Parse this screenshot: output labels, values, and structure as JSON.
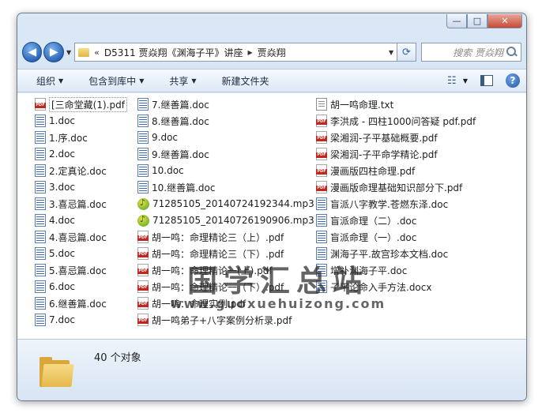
{
  "window": {
    "caption": {
      "minimize": "—",
      "maximize": "□",
      "close": "✕"
    }
  },
  "nav": {
    "back_icon": "back-arrow-icon",
    "forward_icon": "forward-arrow-icon",
    "address": {
      "chevron": "«",
      "segments": [
        "D5311 贾焱翔《渊海子平》讲座",
        "贾焱翔"
      ]
    },
    "search_placeholder": "搜索 贾焱翔"
  },
  "toolbar": {
    "organize": "组织",
    "include_in_library": "包含到库中",
    "share": "共享",
    "new_folder": "新建文件夹"
  },
  "files": {
    "col1": [
      {
        "name": "[三命堂藏(1).pdf",
        "type": "pdf",
        "selected": true
      },
      {
        "name": "1.doc",
        "type": "doc"
      },
      {
        "name": "1.序.doc",
        "type": "doc"
      },
      {
        "name": "2.doc",
        "type": "doc"
      },
      {
        "name": "2.定真论.doc",
        "type": "doc"
      },
      {
        "name": "3.doc",
        "type": "doc"
      },
      {
        "name": "3.喜忌篇.doc",
        "type": "doc"
      },
      {
        "name": "4.doc",
        "type": "doc"
      },
      {
        "name": "4.喜忌篇.doc",
        "type": "doc"
      },
      {
        "name": "5.doc",
        "type": "doc"
      },
      {
        "name": "5.喜忌篇.doc",
        "type": "doc"
      },
      {
        "name": "6.doc",
        "type": "doc"
      },
      {
        "name": "6.继善篇.doc",
        "type": "doc"
      },
      {
        "name": "7.doc",
        "type": "doc"
      }
    ],
    "col2": [
      {
        "name": "7.继善篇.doc",
        "type": "doc"
      },
      {
        "name": "8.继善篇.doc",
        "type": "doc"
      },
      {
        "name": "9.doc",
        "type": "doc"
      },
      {
        "name": "9.继善篇.doc",
        "type": "doc"
      },
      {
        "name": "10.doc",
        "type": "doc"
      },
      {
        "name": "10.继善篇.doc",
        "type": "doc"
      },
      {
        "name": "71285105_20140724192344.mp3",
        "type": "mp3"
      },
      {
        "name": "71285105_20140726190906.mp3",
        "type": "mp3"
      },
      {
        "name": "胡一鸣：命理精论三（上）.pdf",
        "type": "pdf"
      },
      {
        "name": "胡一鸣：命理精论三（下）.pdf",
        "type": "pdf"
      },
      {
        "name": "胡一鸣：命理精论一(上).pdf",
        "type": "pdf"
      },
      {
        "name": "胡一鸣：命理精论一（下）.pdf",
        "type": "pdf"
      },
      {
        "name": "胡一鸣：命理实例.pdf",
        "type": "pdf"
      },
      {
        "name": "胡一鸣弟子+八字案例分析录.pdf",
        "type": "pdf"
      }
    ],
    "col3": [
      {
        "name": "胡一鸣命理.txt",
        "type": "txt"
      },
      {
        "name": "李洪成 - 四柱1000问答疑 pdf.pdf",
        "type": "pdf"
      },
      {
        "name": "梁湘润-子平基础概要.pdf",
        "type": "pdf"
      },
      {
        "name": "梁湘润-子平命学精论.pdf",
        "type": "pdf"
      },
      {
        "name": "漫画版四柱命理.pdf",
        "type": "pdf"
      },
      {
        "name": "漫画版命理基础知识部分下.pdf",
        "type": "pdf"
      },
      {
        "name": "盲派八字教学.苍燃东泽.doc",
        "type": "doc"
      },
      {
        "name": "盲派命理（二）.doc",
        "type": "doc"
      },
      {
        "name": "盲派命理（一）.doc",
        "type": "doc"
      },
      {
        "name": "渊海子平.故宫珍本文档.doc",
        "type": "doc"
      },
      {
        "name": "增补渊海子平.doc",
        "type": "doc"
      },
      {
        "name": "子平论命入手方法.docx",
        "type": "doc"
      }
    ]
  },
  "watermark": {
    "text": "国学汇总站",
    "url": "www.guoxuehuizong.com"
  },
  "details": {
    "count": "40 个对象"
  }
}
